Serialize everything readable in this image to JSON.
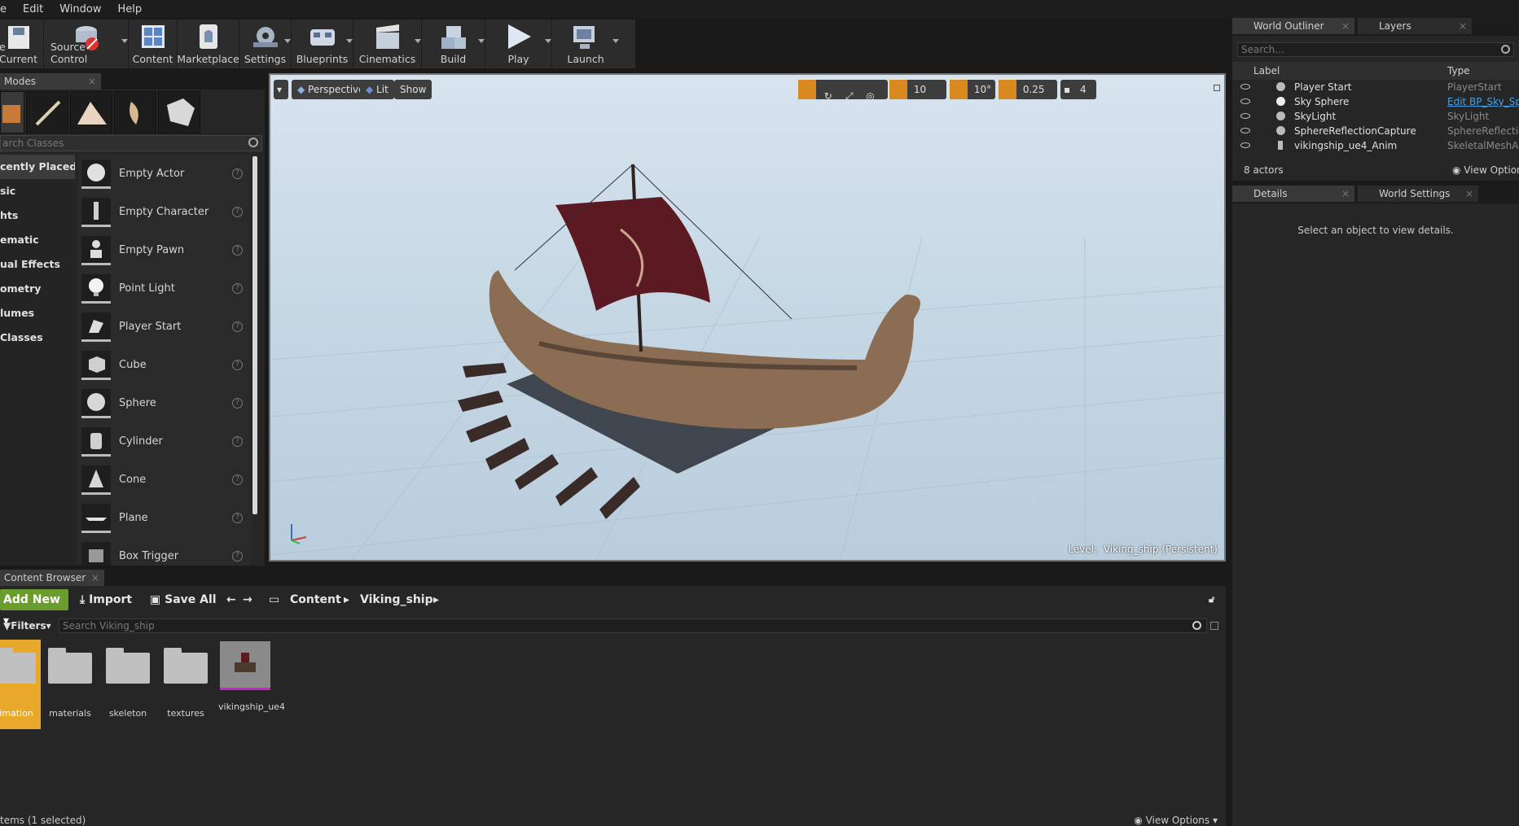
{
  "menu": [
    "e",
    "Edit",
    "Window",
    "Help"
  ],
  "toolbar": [
    {
      "label": "e Current",
      "icon": "save-icon"
    },
    {
      "label": "Source Control",
      "icon": "source-control-icon"
    },
    {
      "label": "Content",
      "icon": "content-icon"
    },
    {
      "label": "Marketplace",
      "icon": "marketplace-icon"
    },
    {
      "label": "Settings",
      "icon": "settings-icon"
    },
    {
      "label": "Blueprints",
      "icon": "blueprints-icon"
    },
    {
      "label": "Cinematics",
      "icon": "cinematics-icon"
    },
    {
      "label": "Build",
      "icon": "build-icon"
    },
    {
      "label": "Play",
      "icon": "play-icon"
    },
    {
      "label": "Launch",
      "icon": "launch-icon"
    }
  ],
  "modes": {
    "tab_label": "Modes",
    "search_placeholder": "arch Classes",
    "categories": [
      "cently Placed",
      "sic",
      "hts",
      "ematic",
      "ual Effects",
      "ometry",
      "lumes",
      "Classes"
    ],
    "items": [
      "Empty Actor",
      "Empty Character",
      "Empty Pawn",
      "Point Light",
      "Player Start",
      "Cube",
      "Sphere",
      "Cylinder",
      "Cone",
      "Plane",
      "Box Trigger"
    ]
  },
  "viewport": {
    "perspective": "Perspective",
    "lit": "Lit",
    "show": "Show",
    "grid_snap": "10",
    "rot_snap": "10°",
    "scale_snap": "0.25",
    "camera_speed": "4",
    "level_label": "Level:",
    "level_name": "Viking_ship (Persistent)"
  },
  "outliner": {
    "tab": "World Outliner",
    "tab2": "Layers",
    "search_placeholder": "Search...",
    "col_label": "Label",
    "col_type": "Type",
    "rows": [
      {
        "name": "Player Start",
        "type": "PlayerStart",
        "link": false
      },
      {
        "name": "Sky Sphere",
        "type": "Edit BP_Sky_Sp",
        "link": true
      },
      {
        "name": "SkyLight",
        "type": "SkyLight",
        "link": false
      },
      {
        "name": "SphereReflectionCapture",
        "type": "SphereReflection",
        "link": false
      },
      {
        "name": "vikingship_ue4_Anim",
        "type": "SkeletalMeshActo",
        "link": false
      }
    ],
    "count": "8 actors",
    "view_options": "View Option"
  },
  "details": {
    "tab": "Details",
    "tab2": "World Settings",
    "message": "Select an object to view details."
  },
  "content_browser": {
    "tab": "Content Browser",
    "add_new": "Add New",
    "import": "Import",
    "save_all": "Save All",
    "crumbs": [
      "Content",
      "Viking_ship"
    ],
    "filters": "Filters",
    "search_placeholder": "Search Viking_ship",
    "assets": [
      "imation",
      "materials",
      "skeleton",
      "textures",
      "vikingship_ue4"
    ],
    "status": "tems (1 selected)",
    "view_options": "View Options"
  }
}
